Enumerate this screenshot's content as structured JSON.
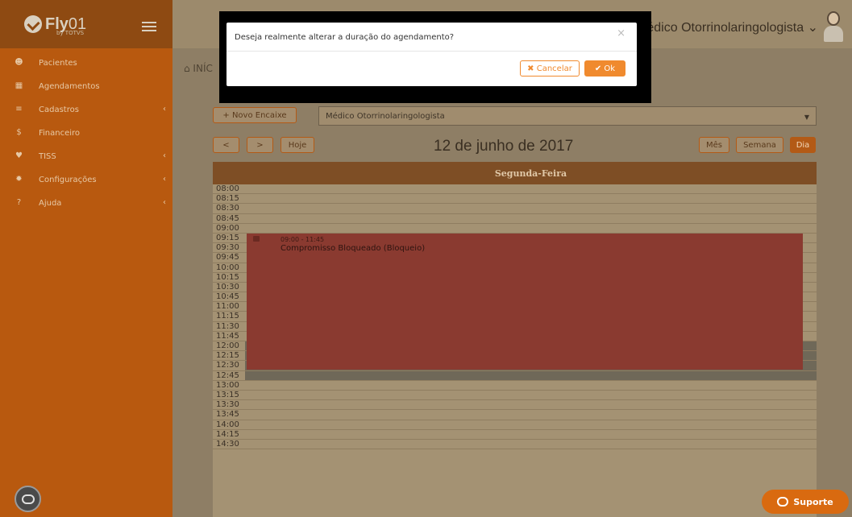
{
  "brand": {
    "name_bold": "Fly",
    "name_thin": "01",
    "sub": "by TOTVS"
  },
  "sidebar": {
    "items": [
      {
        "label": "Pacientes",
        "icon": "users-icon",
        "submenu": false
      },
      {
        "label": "Agendamentos",
        "icon": "calendar-icon",
        "submenu": false
      },
      {
        "label": "Cadastros",
        "icon": "list-icon",
        "submenu": true
      },
      {
        "label": "Financeiro",
        "icon": "dollar-icon",
        "submenu": false
      },
      {
        "label": "TISS",
        "icon": "heart-icon",
        "submenu": true
      },
      {
        "label": "Configurações",
        "icon": "gear-icon",
        "submenu": true
      },
      {
        "label": "Ajuda",
        "icon": "question-icon",
        "submenu": true
      }
    ]
  },
  "header": {
    "doctor": "Médico Otorrinolaringologista ⌄"
  },
  "breadcrumb": {
    "text": "⌂ INÍC"
  },
  "toolbar": {
    "new_button": "+ Novo Encaixe",
    "doctor_select": "Médico Otorrinolaringologista",
    "prev": "<",
    "next": ">",
    "today": "Hoje",
    "month": "Mês",
    "week": "Semana",
    "day": "Dia",
    "date": "12 de junho de 2017"
  },
  "calendar": {
    "day_header": "Segunda-Feira",
    "times": [
      "08:00",
      "08:15",
      "08:30",
      "08:45",
      "09:00",
      "09:15",
      "09:30",
      "09:45",
      "10:00",
      "10:15",
      "10:30",
      "10:45",
      "11:00",
      "11:15",
      "11:30",
      "11:45",
      "12:00",
      "12:15",
      "12:30",
      "12:45",
      "13:00",
      "13:15",
      "13:30",
      "13:45",
      "14:00",
      "14:15",
      "14:30"
    ],
    "event": {
      "time": "09:00 - 11:45",
      "title": "Compromisso Bloqueado (Bloqueio)"
    }
  },
  "modal": {
    "message": "Deseja realmente alterar a duração do agendamento?",
    "close": "×",
    "cancel": "✖ Cancelar",
    "ok": "✔ Ok"
  },
  "support": {
    "label": "Suporte"
  },
  "colors": {
    "accent": "#f08a2e",
    "sidebar": "#b8590f",
    "event": "#8a3a30"
  }
}
